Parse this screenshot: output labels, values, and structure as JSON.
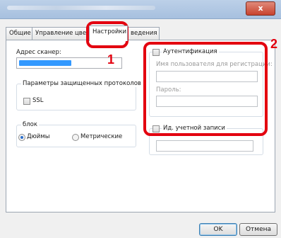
{
  "window": {
    "close_label": "x"
  },
  "tabs": [
    {
      "label": "Общие"
    },
    {
      "label": "Управление цвет"
    },
    {
      "label": "Настройки"
    },
    {
      "label": "ведения"
    }
  ],
  "left": {
    "scanner_address_label": "Адрес сканер:",
    "protocols_group_title": "Параметры защищенных протоколов",
    "ssl_label": "SSL",
    "units_group_title": "блок",
    "inches_label": "Дюймы",
    "metric_label": "Метрические",
    "selected_unit": "inches"
  },
  "right": {
    "auth_label": "Аутентификация",
    "username_label": "Имя пользователя для регистрации:",
    "username_value": "",
    "password_label": "Пароль:",
    "password_value": "",
    "account_id_label": "Ид. учетной записи",
    "account_id_value": ""
  },
  "callouts": {
    "one": "1",
    "two": "2"
  },
  "buttons": {
    "ok": "OK",
    "cancel": "Отмена"
  },
  "colors": {
    "highlight": "#e3000f",
    "selection": "#3399ff"
  }
}
